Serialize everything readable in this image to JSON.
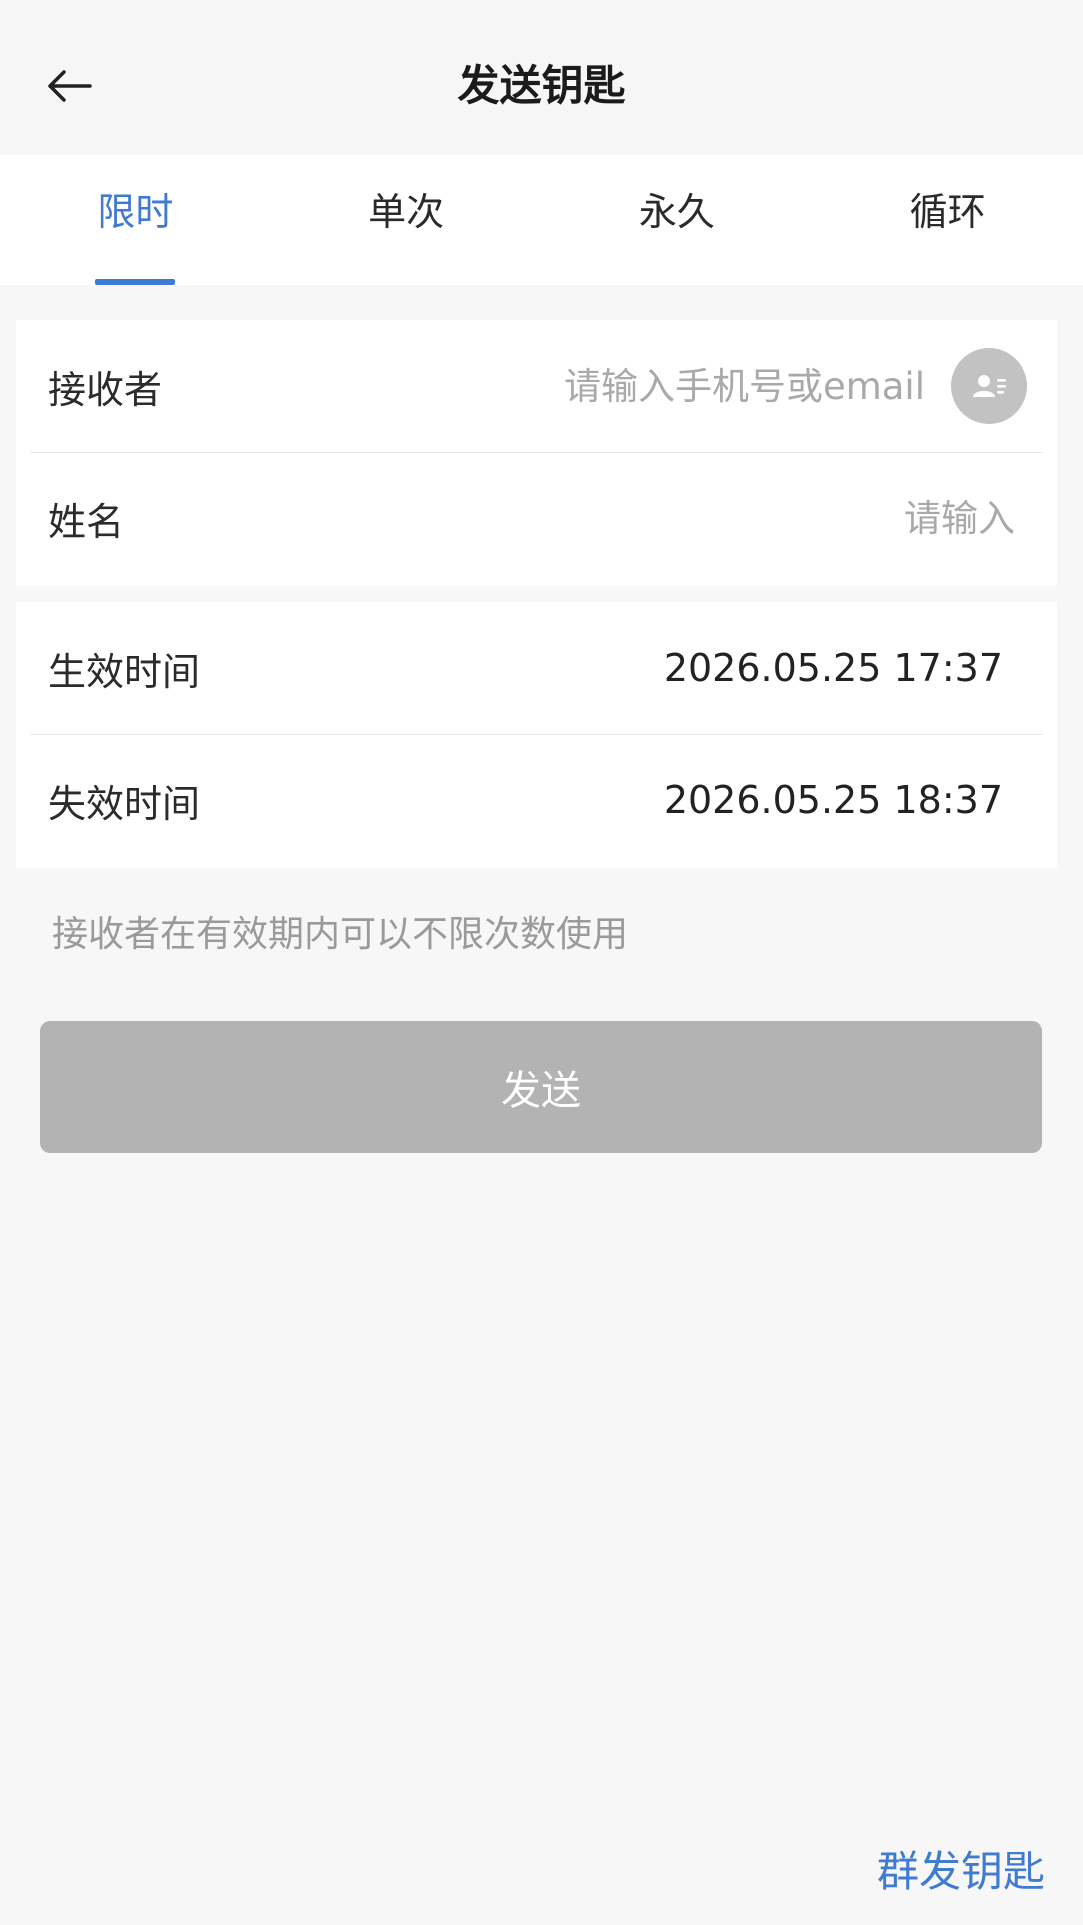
{
  "header": {
    "title": "发送钥匙",
    "back_icon": "arrow-left-icon"
  },
  "tabs": [
    {
      "label": "限时",
      "active": true
    },
    {
      "label": "单次",
      "active": false
    },
    {
      "label": "永久",
      "active": false
    },
    {
      "label": "循环",
      "active": false
    }
  ],
  "recipient": {
    "label": "接收者",
    "placeholder": "请输入手机号或email",
    "value": "",
    "contact_icon": "contact-card-icon"
  },
  "name": {
    "label": "姓名",
    "placeholder": "请输入",
    "value": ""
  },
  "effective_time": {
    "label": "生效时间",
    "value": "2026.05.25 17:37"
  },
  "expiry_time": {
    "label": "失效时间",
    "value": "2026.05.25 18:37"
  },
  "hint": "接收者在有效期内可以不限次数使用",
  "send_button": "发送",
  "group_send": "群发钥匙",
  "colors": {
    "accent": "#3f7bd1",
    "button_disabled": "#b3b3b3",
    "placeholder": "#a9a9a9",
    "background": "#f7f7f7"
  }
}
